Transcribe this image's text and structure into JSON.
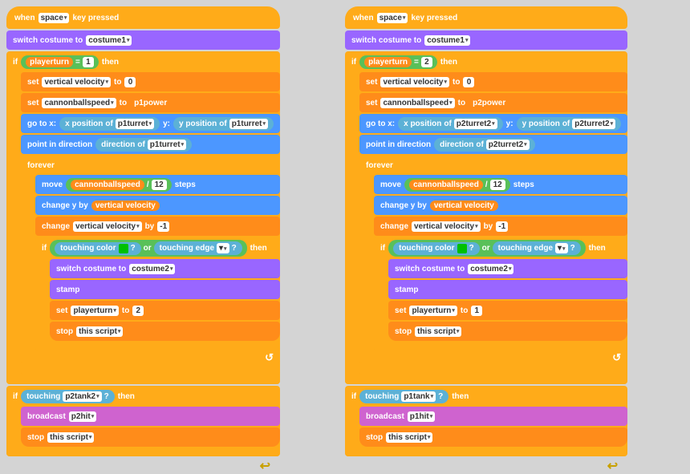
{
  "left": {
    "hat": "when",
    "hat_key": "space",
    "hat_suffix": "key pressed",
    "switch1": "switch costume to",
    "costume1": "costume1",
    "if1_var": "playerturn",
    "if1_eq": "=",
    "if1_val": "1",
    "if1_then": "then",
    "set1_var": "vertical velocity",
    "set1_to": "to",
    "set1_val": "0",
    "set2_var": "cannonballspeed",
    "set2_to": "to",
    "set2_val": "p1power",
    "goto": "go to x:",
    "x_sense": "x position",
    "x_of": "of",
    "x_var": "p1turret",
    "y_label": "y:",
    "y_sense": "y position",
    "y_of": "of",
    "y_var": "p1turret",
    "point": "point in direction",
    "dir_sense": "direction",
    "dir_of": "of",
    "dir_var": "p1turret",
    "forever": "forever",
    "move": "move",
    "move_var": "cannonballspeed",
    "move_div": "/",
    "move_val": "12",
    "move_steps": "steps",
    "changey": "change y by",
    "changey_var": "vertical velocity",
    "changevel": "change",
    "changevel_var": "vertical velocity",
    "changevel_by": "by",
    "changevel_val": "-1",
    "if2_touching": "touching color",
    "if2_color": "green",
    "if2_or": "or",
    "if2_edge": "touching edge",
    "if2_then": "then",
    "switch2": "switch costume to",
    "costume2": "costume2",
    "stamp": "stamp",
    "set3_var": "playerturn",
    "set3_to": "to",
    "set3_val": "2",
    "stop1": "stop",
    "stop1_val": "this script",
    "if3_touching": "touching",
    "if3_var": "p2tank2",
    "if3_then": "then",
    "broadcast1": "broadcast",
    "broadcast1_val": "p2hit",
    "stop2": "stop",
    "stop2_val": "this script"
  },
  "right": {
    "hat": "when",
    "hat_key": "space",
    "hat_suffix": "key pressed",
    "switch1": "switch costume to",
    "costume1": "costume1",
    "if1_var": "playerturn",
    "if1_eq": "=",
    "if1_val": "2",
    "if1_then": "then",
    "set1_var": "vertical velocity",
    "set1_to": "to",
    "set1_val": "0",
    "set2_var": "cannonballspeed",
    "set2_to": "to",
    "set2_val": "p2power",
    "goto": "go to x:",
    "x_sense": "x position",
    "x_of": "of",
    "x_var": "p2turret2",
    "y_label": "y:",
    "y_sense": "y position",
    "y_of": "of",
    "y_var": "p2turret2",
    "point": "point in direction",
    "dir_sense": "direction",
    "dir_of": "of",
    "dir_var": "p2turret2",
    "forever": "forever",
    "move": "move",
    "move_var": "cannonballspeed",
    "move_div": "/",
    "move_val": "12",
    "move_steps": "steps",
    "changey": "change y by",
    "changey_var": "vertical velocity",
    "changevel": "change",
    "changevel_var": "vertical velocity",
    "changevel_by": "by",
    "changevel_val": "-1",
    "if2_touching": "touching color",
    "if2_color": "green",
    "if2_or": "or",
    "if2_edge": "touching edge",
    "if2_then": "then",
    "switch2": "switch costume to",
    "costume2": "costume2",
    "stamp": "stamp",
    "set3_var": "playerturn",
    "set3_to": "to",
    "set3_val": "1",
    "stop1": "stop",
    "stop1_val": "this script",
    "if3_touching": "touching",
    "if3_var": "p1tank",
    "if3_then": "then",
    "broadcast1": "broadcast",
    "broadcast1_val": "p1hit",
    "stop2": "stop",
    "stop2_val": "this script"
  }
}
